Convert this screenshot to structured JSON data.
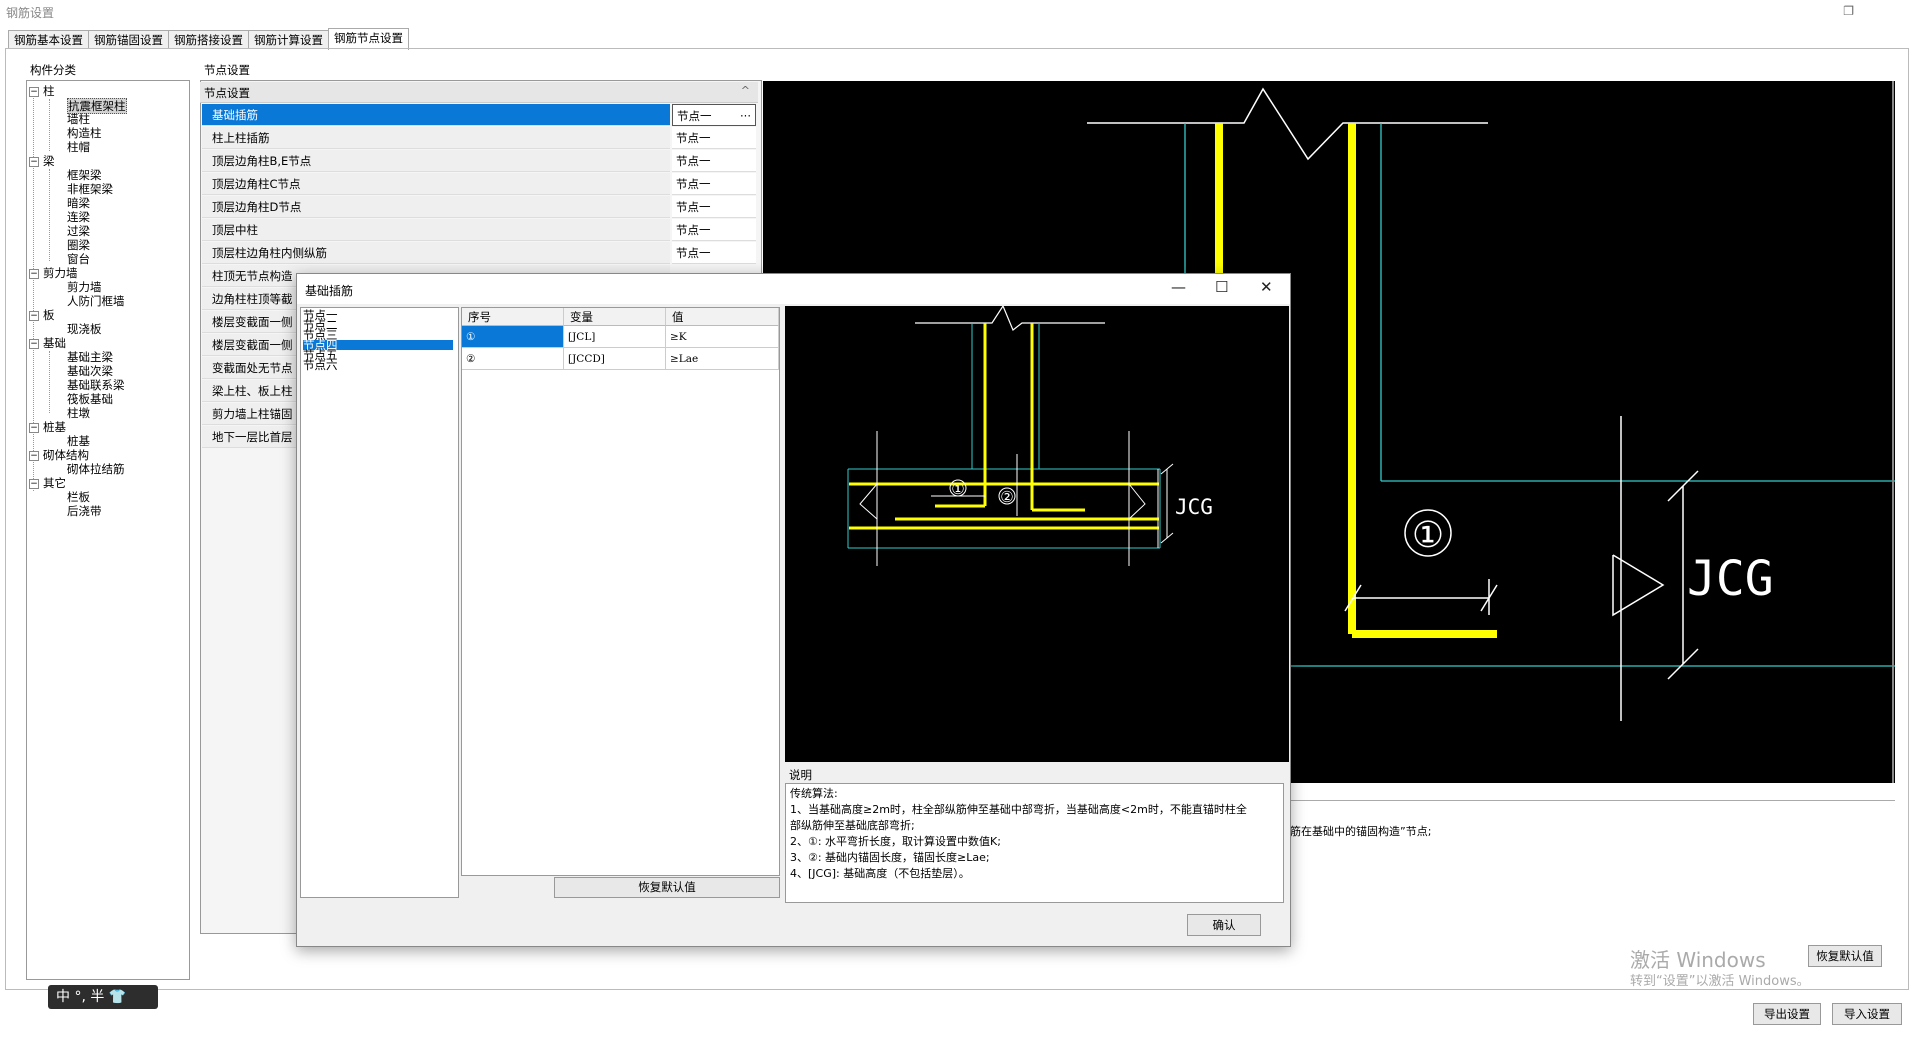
{
  "window": {
    "title": "钢筋设置"
  },
  "tabs": [
    "钢筋基本设置",
    "钢筋锚固设置",
    "钢筋搭接设置",
    "钢筋计算设置",
    "钢筋节点设置"
  ],
  "tab_active": 4,
  "component_label": "构件分类",
  "node_settings_label": "节点设置",
  "tree": {
    "col": "柱",
    "col_items": [
      "抗震框架柱",
      "墙柱",
      "构造柱",
      "柱帽"
    ],
    "beam": "梁",
    "beam_items": [
      "框架梁",
      "非框架梁",
      "暗梁",
      "连梁",
      "过梁",
      "圈梁",
      "窗台"
    ],
    "wall": "剪力墙",
    "wall_items": [
      "剪力墙",
      "人防门框墙"
    ],
    "slab": "板",
    "slab_items": [
      "现浇板"
    ],
    "found": "基础",
    "found_items": [
      "基础主梁",
      "基础次梁",
      "基础联系梁",
      "筏板基础",
      "柱墩"
    ],
    "pile": "桩基",
    "pile_items": [
      "桩基"
    ],
    "masonry": "砌体结构",
    "masonry_items": [
      "砌体拉结筋"
    ],
    "other": "其它",
    "other_items": [
      "栏板",
      "后浇带"
    ]
  },
  "grid_header": "节点设置",
  "props": [
    {
      "name": "基础插筋",
      "value": "节点一"
    },
    {
      "name": "柱上柱插筋",
      "value": "节点一"
    },
    {
      "name": "顶层边角柱B,E节点",
      "value": "节点一"
    },
    {
      "name": "顶层边角柱C节点",
      "value": "节点一"
    },
    {
      "name": "顶层边角柱D节点",
      "value": "节点一"
    },
    {
      "name": "顶层中柱",
      "value": "节点一"
    },
    {
      "name": "顶层柱边角柱内侧纵筋",
      "value": "节点一"
    },
    {
      "name": "柱顶无节点构造",
      "value": ""
    },
    {
      "name": "边角柱柱顶等截",
      "value": ""
    },
    {
      "name": "楼层变截面一侧",
      "value": ""
    },
    {
      "name": "楼层变截面一侧",
      "value": ""
    },
    {
      "name": "变截面处无节点",
      "value": ""
    },
    {
      "name": "梁上柱、板上柱",
      "value": ""
    },
    {
      "name": "剪力墙上柱锚固",
      "value": ""
    },
    {
      "name": "地下一层比首层",
      "value": ""
    }
  ],
  "ellipsis": "···",
  "collapse_glyph": "^",
  "behind_text": "筋在基础中的锚固构造”节点;",
  "btn_restore_main": "恢复默认值",
  "btn_export": "导出设置",
  "btn_import": "导入设置",
  "watermark1": "激活 Windows",
  "watermark2": "转到“设置”以激活 Windows。",
  "ime": "中 °, 半 👕",
  "dialog": {
    "title": "基础插筋",
    "nodes": [
      "节点一",
      "节点二",
      "节点三",
      "节点四",
      "节点五",
      "节点六"
    ],
    "selected_node": 3,
    "grid_cols": [
      "序号",
      "变量",
      "值"
    ],
    "grid_rows": [
      {
        "no": "①",
        "var": "[JCL]",
        "val": "≥K"
      },
      {
        "no": "②",
        "var": "[JCCD]",
        "val": "≥Lae"
      }
    ],
    "restore": "恢复默认值",
    "explain_label": "说明",
    "explain_lines": [
      "传统算法:",
      "1、当基础高度≥2m时，柱全部纵筋伸至基础中部弯折，当基础高度<2m时，不能直锚时柱全",
      "部纵筋伸至基础底部弯折;",
      "2、①: 水平弯折长度，取计算设置中数值K;",
      "3、②: 基础内锚固长度，锚固长度≥Lae;",
      "4、[JCG]: 基础高度（不包括垫层）。"
    ],
    "ok": "确认",
    "minimize": "—",
    "maximize": "☐",
    "close": "✕"
  },
  "drawing": {
    "label_jcg": "JCG",
    "label_1": "①",
    "label_2": "②"
  }
}
